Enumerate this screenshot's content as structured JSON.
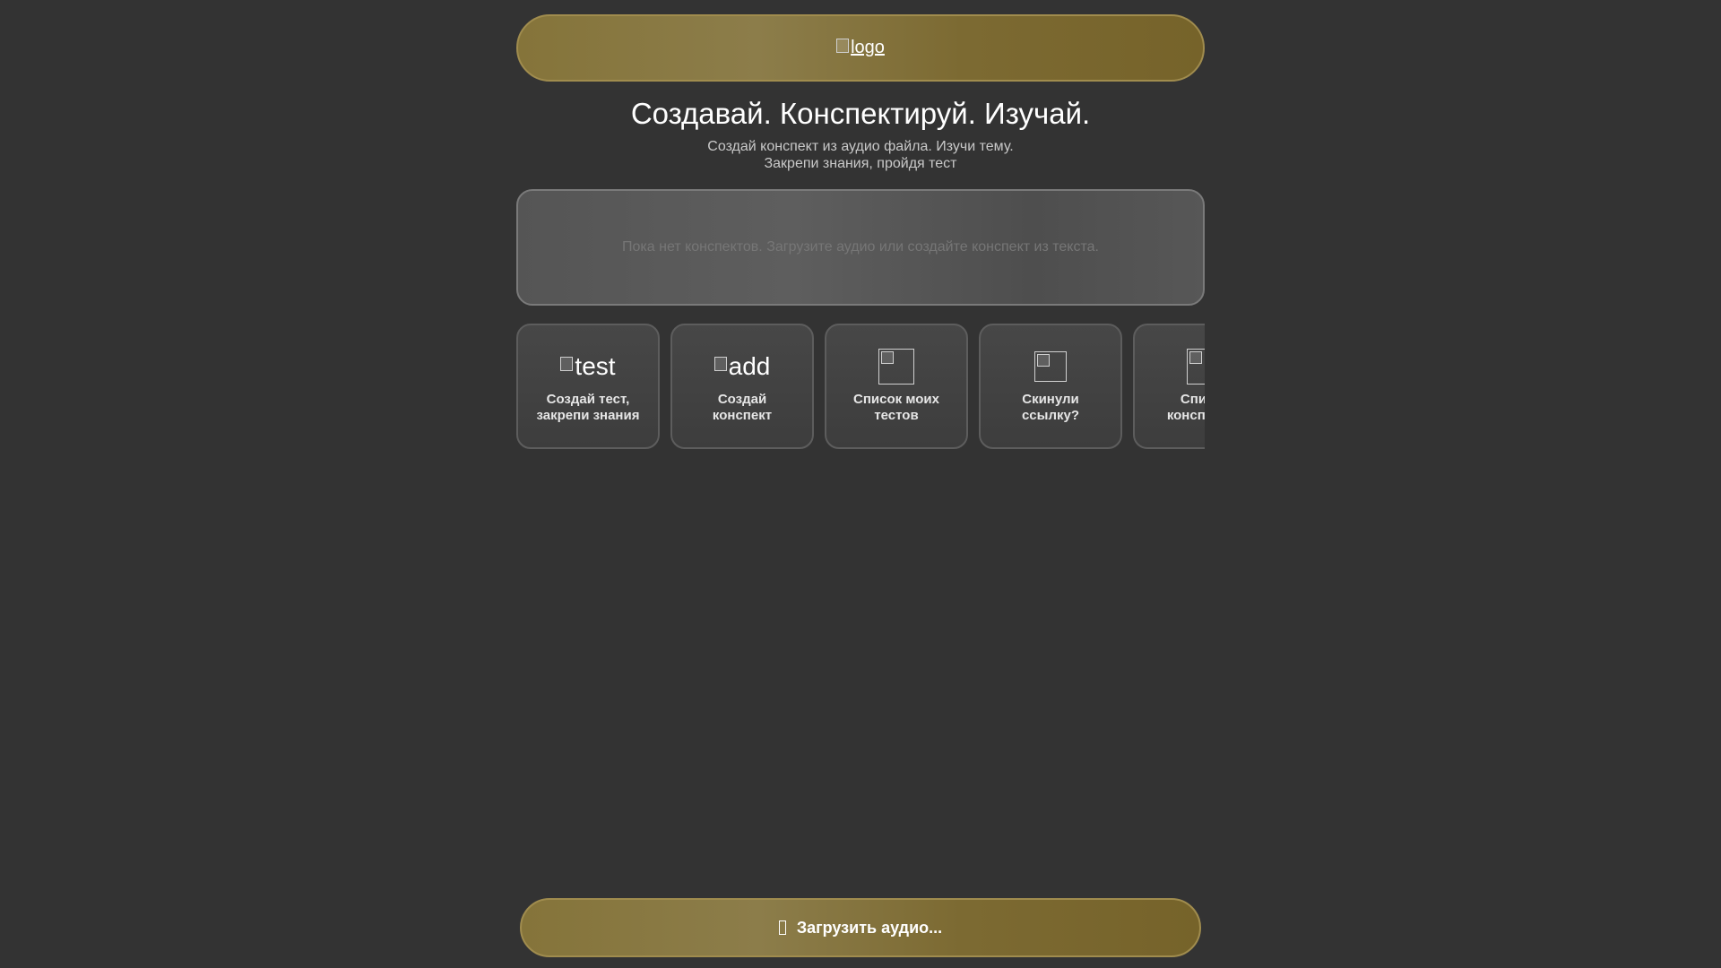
{
  "header": {
    "logo_alt": "logo"
  },
  "hero": {
    "title": "Создавай. Конспектируй. Изучай.",
    "subtitle_line1": "Создай конспект из аудио файла. Изучи тему.",
    "subtitle_line2": "Закрепи знания, пройдя тест"
  },
  "notes": {
    "empty_text": "Пока нет конспектов. Загрузите аудио или создайте конспект из текста."
  },
  "cards": [
    {
      "icon_alt": "test",
      "line1": "Создай тест,",
      "line2": "закрепи знания"
    },
    {
      "icon_alt": "add",
      "line1": "Создай",
      "line2": "конспект"
    },
    {
      "icon_alt": "",
      "line1": "Список моих",
      "line2": "тестов"
    },
    {
      "icon_alt": "",
      "line1": "Скинули",
      "line2": "ссылку?"
    },
    {
      "icon_alt": "",
      "line1": "Список",
      "line2": "конспектов"
    }
  ],
  "upload": {
    "label": "Загрузить аудио..."
  },
  "colors": {
    "background": "#333333",
    "accent_gold": "#85743a",
    "accent_gold_border": "#a08c4e"
  }
}
